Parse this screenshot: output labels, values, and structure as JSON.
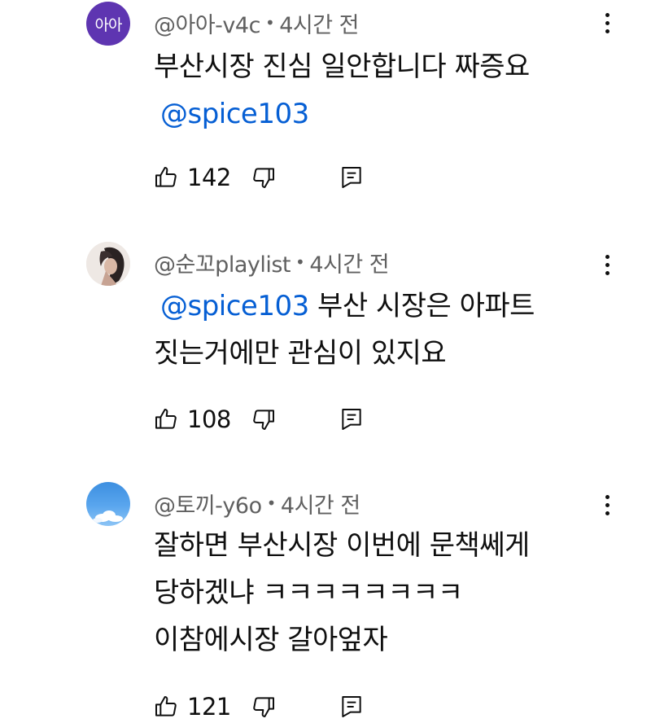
{
  "comments": [
    {
      "avatar_text": "아아",
      "author": "@아아-v4c",
      "separator": "•",
      "time": "4시간 전",
      "lines": [
        {
          "text": "부산시장 진심 일안합니다 짜증요"
        },
        {
          "mention": "@spice103"
        }
      ],
      "likes": "142"
    },
    {
      "author": "@순꼬playlist",
      "separator": "•",
      "time": "4시간 전",
      "lines": [
        {
          "mention": "@spice103",
          "text": " 부산 시장은 아파트"
        },
        {
          "text": "짓는거에만 관심이 있지요"
        }
      ],
      "likes": "108"
    },
    {
      "author": "@토끼-y6o",
      "separator": "•",
      "time": "4시간 전",
      "lines": [
        {
          "text": "잘하면 부산시장 이번에 문책쎄게"
        },
        {
          "text": "당하겠냐 ㅋㅋㅋㅋㅋㅋㅋㅋ"
        },
        {
          "text": "이참에시장 갈아엎자"
        }
      ],
      "likes": "121"
    }
  ],
  "icons": {
    "like": "thumbs-up-icon",
    "dislike": "thumbs-down-icon",
    "reply": "reply-icon",
    "more": "more-vert-icon"
  },
  "colors": {
    "mention": "#065fd4",
    "meta": "#606060",
    "avatar_1": "#5e35b1",
    "text": "#0f0f0f"
  }
}
